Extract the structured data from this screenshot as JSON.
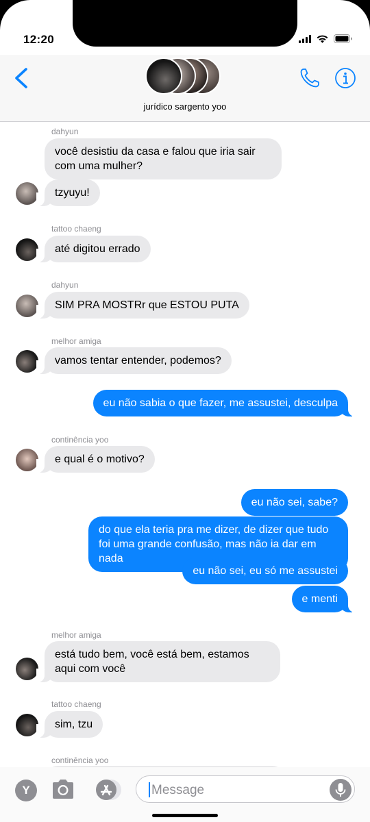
{
  "status_bar": {
    "time": "12:20"
  },
  "header": {
    "group_name": "jurídico sargento yoo"
  },
  "messages": [
    {
      "sender": "dahyun",
      "text": "você desistiu da casa e falou que iria sair com uma mulher?"
    },
    {
      "text": "tzyuyu!"
    },
    {
      "sender": "tattoo chaeng",
      "text": "até digitou errado"
    },
    {
      "sender": "dahyun",
      "text": "SIM PRA MOSTRr que ESTOU PUTA"
    },
    {
      "sender": "melhor amiga",
      "text": "vamos tentar entender, podemos?"
    },
    {
      "text": "eu não sabia o que fazer, me assustei, desculpa"
    },
    {
      "sender": "continência yoo",
      "text": "e qual é o motivo?"
    },
    {
      "text": "eu não sei, sabe?"
    },
    {
      "text": "do que ela teria pra me dizer, de dizer que tudo foi uma grande confusão, mas não ia dar em nada"
    },
    {
      "text": "eu não sei, eu só me assustei"
    },
    {
      "text": "e menti"
    },
    {
      "sender": "melhor amiga",
      "text": "está tudo bem, você está bem, estamos aqui com você"
    },
    {
      "sender": "tattoo chaeng",
      "text": "sim, tzu"
    },
    {
      "sender": "continência yoo",
      "text": ""
    }
  ],
  "composer": {
    "placeholder": "Message",
    "apps_button_label": "Y"
  },
  "colors": {
    "accent": "#0b84ff",
    "incoming_bubble": "#e9e9eb",
    "sender_label": "#8e8e93"
  }
}
